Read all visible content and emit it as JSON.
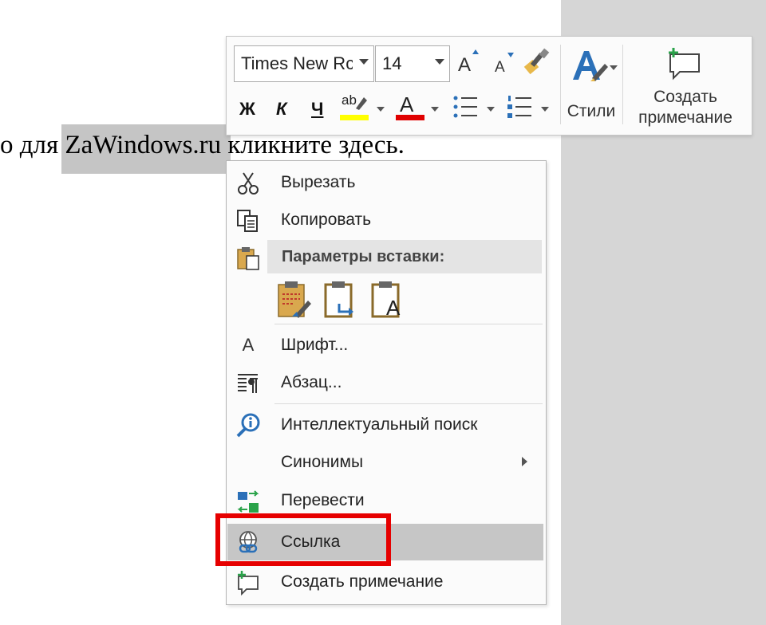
{
  "document": {
    "text_line": "о для ZaWindows.ru кликните здесь."
  },
  "mini_toolbar": {
    "font_name": "Times New Rc",
    "font_size": "14",
    "grow_font_label": "A",
    "shrink_font_label": "A",
    "bold_label": "Ж",
    "italic_label": "К",
    "underline_label": "Ч",
    "highlight_label": "ab",
    "font_color_label": "A",
    "styles_label": "Стили",
    "new_comment_line1": "Создать",
    "new_comment_line2": "примечание",
    "colors": {
      "highlight": "#ffff00",
      "font_color": "#e00000",
      "accent": "#2b70b8"
    }
  },
  "context_menu": {
    "items": [
      {
        "label": "Вырезать",
        "icon": "scissors-icon"
      },
      {
        "label": "Копировать",
        "icon": "copy-icon"
      },
      {
        "label": "Параметры вставки:",
        "icon": "paste-icon"
      },
      {
        "label": "Шрифт...",
        "icon": "font-icon",
        "icon_glyph": "A"
      },
      {
        "label": "Абзац...",
        "icon": "paragraph-icon"
      },
      {
        "label": "Интеллектуальный поиск",
        "icon": "smart-lookup-icon"
      },
      {
        "label": "Синонимы",
        "icon": ""
      },
      {
        "label": "Перевести",
        "icon": "translate-icon"
      },
      {
        "label": "Ссылка",
        "icon": "link-icon"
      },
      {
        "label": "Создать примечание",
        "icon": "new-comment-icon"
      }
    ],
    "paste_options": [
      "keep-source-formatting",
      "merge-formatting",
      "keep-text-only"
    ],
    "paste_text_glyph": "A",
    "highlight_color": "#e60000"
  }
}
